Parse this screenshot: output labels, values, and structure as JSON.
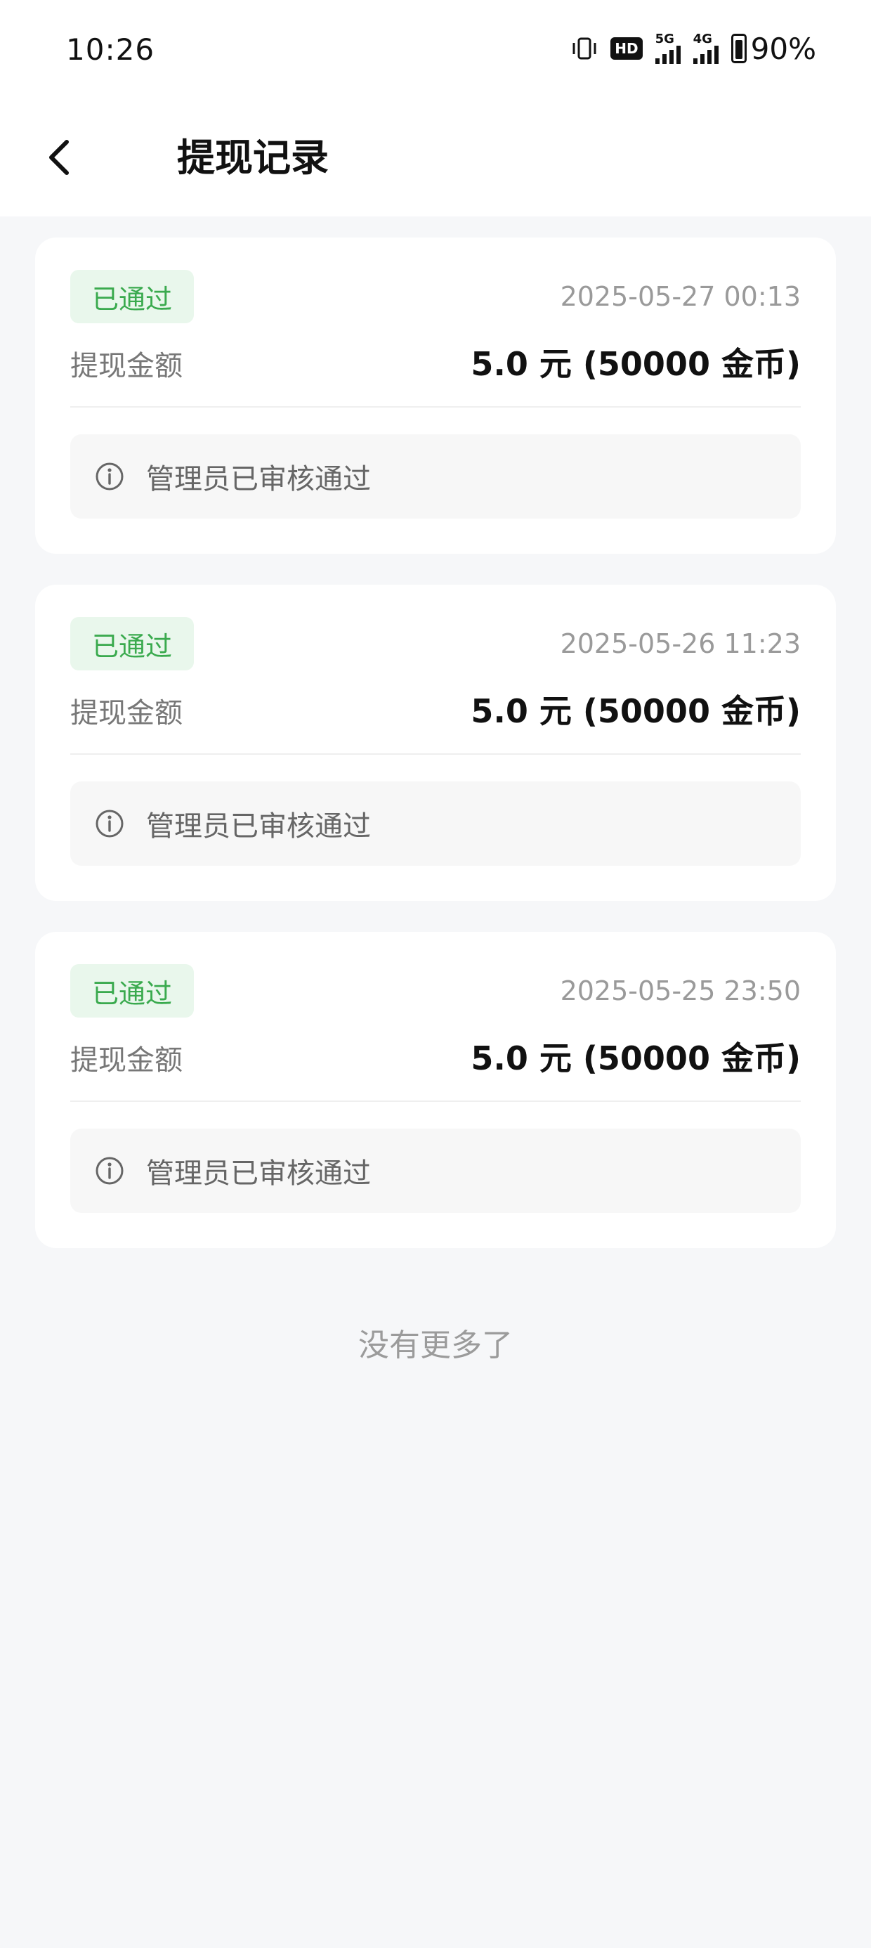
{
  "status_bar": {
    "time": "10:26",
    "hd_label": "HD",
    "network_1": "5G",
    "network_2": "4G",
    "battery_percent": 90,
    "battery_text": "90%"
  },
  "header": {
    "title": "提现记录",
    "back_icon": "chevron-left-icon"
  },
  "records": [
    {
      "status": "已通过",
      "time": "2025-05-27 00:13",
      "amount_label": "提现金额",
      "amount": "5.0 元 (50000 金币)",
      "note": "管理员已审核通过"
    },
    {
      "status": "已通过",
      "time": "2025-05-26 11:23",
      "amount_label": "提现金额",
      "amount": "5.0 元 (50000 金币)",
      "note": "管理员已审核通过"
    },
    {
      "status": "已通过",
      "time": "2025-05-25 23:50",
      "amount_label": "提现金额",
      "amount": "5.0 元 (50000 金币)",
      "note": "管理员已审核通过"
    }
  ],
  "footer": {
    "no_more": "没有更多了"
  },
  "colors": {
    "approved_green": "#3aaa4e",
    "approved_bg": "#e9f7ec",
    "page_bg": "#f6f7f9"
  }
}
